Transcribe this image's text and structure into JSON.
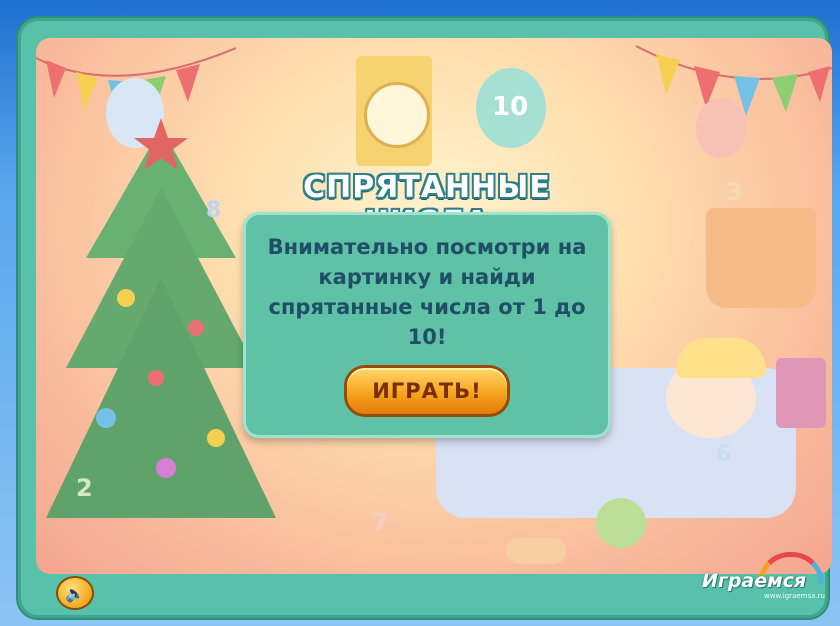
{
  "game": {
    "title": "СПРЯТАННЫЕ ЧИСЛА",
    "instructions": "Внимательно посмотри на картинку и найди спрятанные числа от 1 до 10!",
    "play_button_label": "ИГРАТЬ!"
  },
  "brand": {
    "logo_text": "Играемся",
    "logo_url": "www.igraemsa.ru"
  },
  "scene": {
    "hidden_digits_visible": [
      "10",
      "8",
      "3",
      "2",
      "7",
      "6"
    ]
  },
  "controls": {
    "sound_icon": "speaker-icon"
  },
  "colors": {
    "frame": "#57c1a9",
    "panel": "#5fc2a6",
    "title_text": "#ffffff",
    "instruction_text": "#1f4f66",
    "button": "#f7a51f"
  }
}
